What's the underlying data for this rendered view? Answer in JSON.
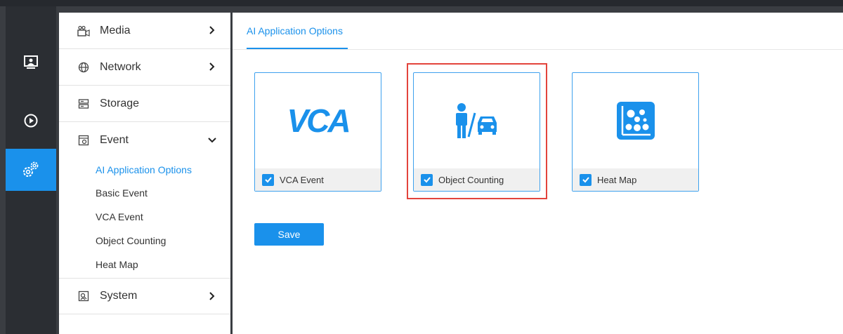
{
  "nav": {
    "media": "Media",
    "network": "Network",
    "storage": "Storage",
    "event": "Event",
    "event_children": [
      "AI Application Options",
      "Basic Event",
      "VCA Event",
      "Object Counting",
      "Heat Map"
    ],
    "system": "System"
  },
  "tabs": {
    "active": "AI Application Options"
  },
  "cards": [
    {
      "icon": "vca-logo",
      "logo_text": "VCA",
      "label": "VCA Event",
      "checked": true
    },
    {
      "icon": "person-car-icon",
      "label": "Object Counting",
      "checked": true,
      "highlighted": true
    },
    {
      "icon": "heat-map-icon",
      "label": "Heat Map",
      "checked": true
    }
  ],
  "save_label": "Save",
  "colors": {
    "accent": "#1a91eb",
    "highlight": "#e3443c",
    "rail": "#2b2e33"
  }
}
